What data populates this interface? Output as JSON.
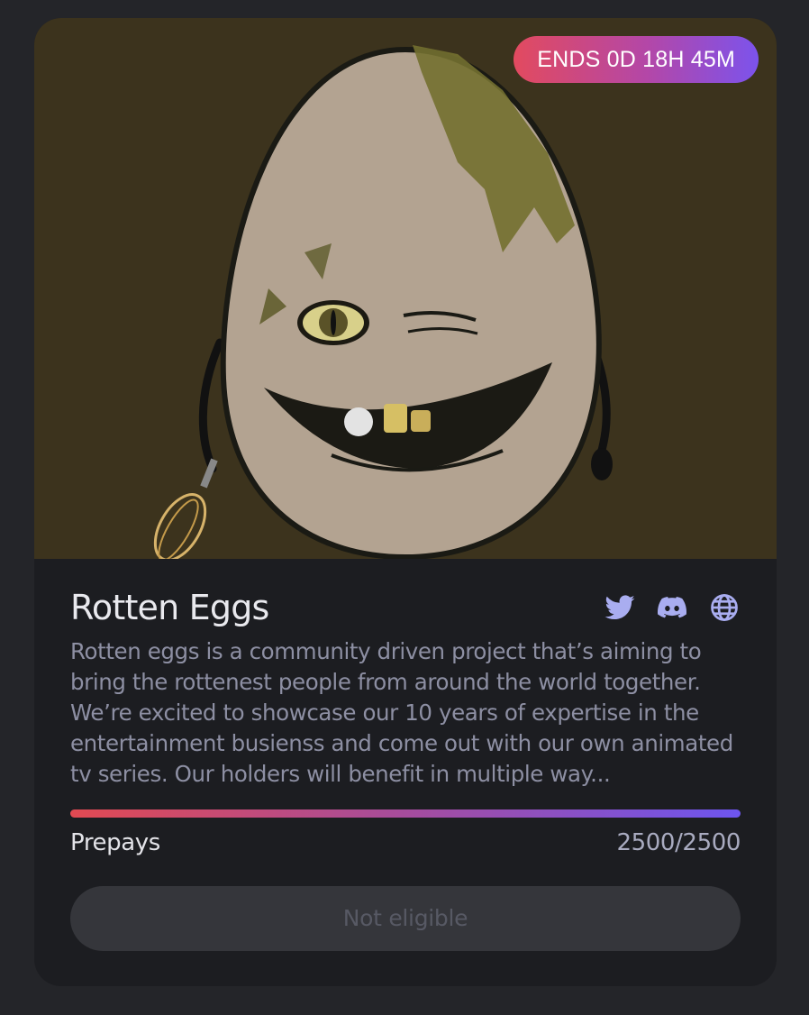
{
  "drop": {
    "countdown": "ENDS 0D 18H 45M",
    "title": "Rotten Eggs",
    "description": "Rotten eggs is a community driven project that’s aiming to bring the rottenest people from around the world together. We’re excited to showcase our 10 years of expertise in the entertainment busienss and come out with our own animated tv series. Our holders will benefit in multiple way...",
    "socials": [
      "twitter-icon",
      "discord-icon",
      "globe-icon"
    ],
    "progress_fraction": 1.0,
    "progress_label": "Prepays",
    "progress_count": "2500/2500",
    "action_label": "Not eligible"
  },
  "colors": {
    "accent_start": "#e24a52",
    "accent_end": "#6d55f0",
    "icon_color": "#a9adf0"
  }
}
